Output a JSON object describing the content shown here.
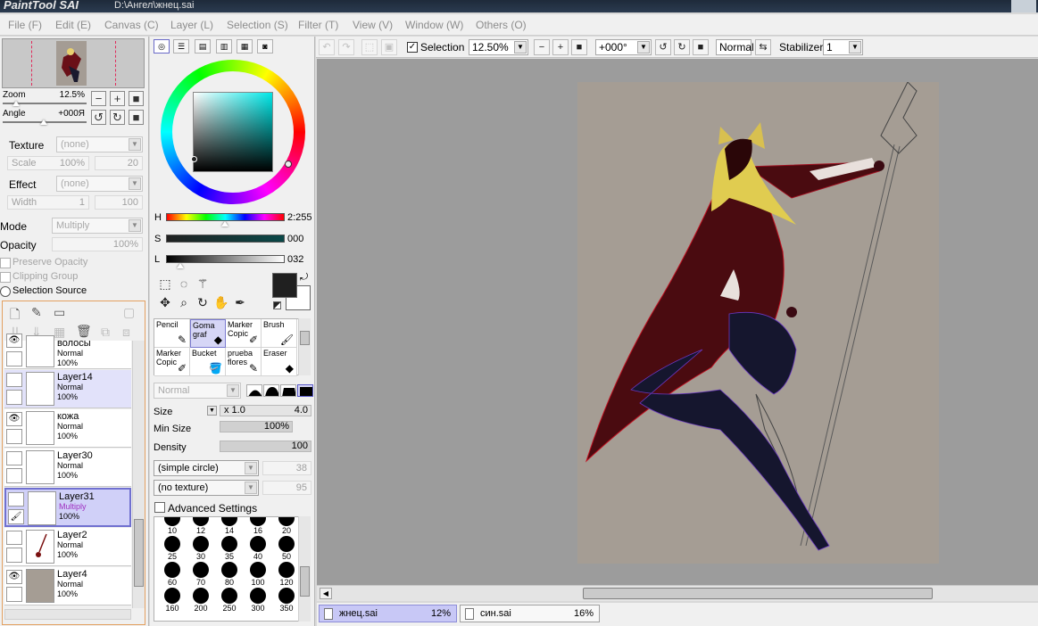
{
  "app": {
    "logo": "PaintTool SAI",
    "path": "D:\\Ангел\\жнец.sai"
  },
  "menu": [
    "File (F)",
    "Edit (E)",
    "Canvas (C)",
    "Layer (L)",
    "Selection (S)",
    "Filter (T)",
    "View (V)",
    "Window (W)",
    "Others (O)"
  ],
  "navigator": {
    "zoom_label": "Zoom",
    "zoom_value": "12.5%",
    "angle_label": "Angle",
    "angle_value": "+000Я"
  },
  "texture": {
    "label": "Texture",
    "value": "(none)",
    "scale_label": "Scale",
    "scale_value": "100%",
    "scale_num": "20"
  },
  "effect": {
    "label": "Effect",
    "value": "(none)",
    "width_label": "Width",
    "width_value": "1",
    "width_num": "100"
  },
  "blend": {
    "mode_label": "Mode",
    "mode_value": "Multiply",
    "opacity_label": "Opacity",
    "opacity_value": "100%"
  },
  "options": {
    "preserve_opacity": "Preserve Opacity",
    "clipping_group": "Clipping Group",
    "selection_source": "Selection Source"
  },
  "layers": [
    {
      "name": "волосы",
      "mode": "Normal",
      "opacity": "100%",
      "visible": true,
      "state": "normal",
      "preview": "#ffffff"
    },
    {
      "name": "Layer14",
      "mode": "Normal",
      "opacity": "100%",
      "visible": false,
      "state": "selected",
      "preview": "#ffffff"
    },
    {
      "name": "кожа",
      "mode": "Normal",
      "opacity": "100%",
      "visible": true,
      "state": "normal",
      "preview": "#ffffff"
    },
    {
      "name": "Layer30",
      "mode": "Normal",
      "opacity": "100%",
      "visible": false,
      "state": "normal",
      "preview": "#ffffff"
    },
    {
      "name": "Layer31",
      "mode": "Multiply",
      "opacity": "100%",
      "visible": false,
      "state": "active",
      "preview": "#ffffff"
    },
    {
      "name": "Layer2",
      "mode": "Normal",
      "opacity": "100%",
      "visible": false,
      "state": "normal",
      "preview": "#ffffff"
    },
    {
      "name": "Layer4",
      "mode": "Normal",
      "opacity": "100%",
      "visible": true,
      "state": "normal",
      "preview": "#a59d94"
    }
  ],
  "color": {
    "h_label": "H",
    "h_value": "2:255",
    "s_label": "S",
    "s_value": "000",
    "l_label": "L",
    "l_value": "032",
    "foreground": "#202020",
    "background": "#ffffff"
  },
  "brushes": [
    {
      "name": "Pencil",
      "icon": "pencil-icon",
      "selected": false
    },
    {
      "name": "Goma graf",
      "icon": "eraser-icon",
      "selected": true
    },
    {
      "name": "Marker Copic",
      "icon": "marker-icon",
      "selected": false
    },
    {
      "name": "Brush",
      "icon": "brush-icon",
      "selected": false
    },
    {
      "name": "Marker Copic",
      "icon": "marker-icon",
      "selected": false
    },
    {
      "name": "Bucket",
      "icon": "bucket-icon",
      "selected": false
    },
    {
      "name": "prueba flores",
      "icon": "pencil-icon",
      "selected": false
    },
    {
      "name": "Eraser",
      "icon": "eraser-icon",
      "selected": false
    }
  ],
  "brush_settings": {
    "blend_mode": "Normal",
    "size_label": "Size",
    "size_mult": "x 1.0",
    "size_value": "4.0",
    "min_size_label": "Min Size",
    "min_size_value": "100%",
    "density_label": "Density",
    "density_value": "100",
    "shape_value": "(simple circle)",
    "shape_num": "38",
    "texture_value": "(no texture)",
    "texture_num": "95",
    "advanced_label": "Advanced Settings"
  },
  "brush_sizes": [
    "10",
    "12",
    "14",
    "16",
    "20",
    "25",
    "30",
    "35",
    "40",
    "50",
    "60",
    "70",
    "80",
    "100",
    "120",
    "160",
    "200",
    "250",
    "300",
    "350"
  ],
  "toolbar": {
    "selection_label": "Selection",
    "zoom_value": "12.50%",
    "angle_value": "+000°",
    "blend_value": "Normal",
    "stabilizer_label": "Stabilizer",
    "stabilizer_value": "1"
  },
  "files": [
    {
      "name": "жнец.sai",
      "zoom": "12%",
      "active": true
    },
    {
      "name": "син.sai",
      "zoom": "16%",
      "active": false
    }
  ]
}
